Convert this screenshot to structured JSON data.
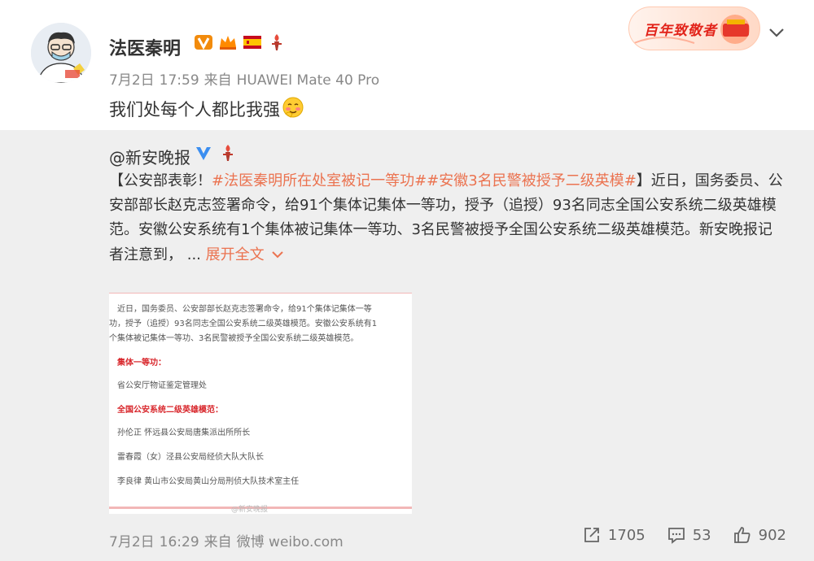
{
  "post": {
    "author": "法医秦明",
    "date": "7月2日",
    "time": "17:59",
    "source_prefix": "来自",
    "device": "HUAWEI Mate 40 Pro",
    "text": "我们处每个人都比我强",
    "badges": [
      "vip-v-icon",
      "crown-icon",
      "spain-flag-icon",
      "torch-icon"
    ]
  },
  "promo": {
    "label": "百年致敬者"
  },
  "repost": {
    "user": "@新安晚报",
    "open_bracket": "【",
    "lead": "公安部表彰！",
    "topic1": "#法医秦明所在处室被记一等功#",
    "topic2": "#安徽3名民警被授予二级英模#",
    "close_bracket": "】",
    "body": "近日，国务委员、公安部部长赵克志签署命令，给91个集体记集体一等功，授予（追授）93名同志全国公安系统二级英雄模范。安徽公安系统有1个集体被记集体一等功、3名民警被授予全国公安系统二级英雄模范。新安晚报记者注意到，",
    "ellipsis": "...",
    "expand": "展开全文",
    "image_lines": {
      "l1": "近日，国务委员、公安部部长赵克志签署命令，给91个集体记集体一等",
      "l2": "功，授予（追授）93名同志全国公安系统二级英雄模范。安徽公安系统有1",
      "l3": "个集体被记集体一等功、3名民警被授予全国公安系统二级英雄模范。",
      "h1": "集体一等功：",
      "l4": "省公安厅物证鉴定管理处",
      "h2": "全国公安系统二级英雄模范：",
      "l5": "孙伦正  怀远县公安局唐集派出所所长",
      "l6": "雷春霞（女）泾县公安局经侦大队大队长",
      "l7": "李良律  黄山市公安局黄山分局刑侦大队技术室主任",
      "watermark": "@新安晚报"
    },
    "date": "7月2日",
    "time": "16:29",
    "source_prefix": "来自",
    "client": "微博 weibo.com",
    "reposts": "1705",
    "comments": "53",
    "likes": "902"
  },
  "colors": {
    "topic": "#eb7350",
    "promo_red": "#e2231a",
    "repost_bg": "#efefef"
  }
}
